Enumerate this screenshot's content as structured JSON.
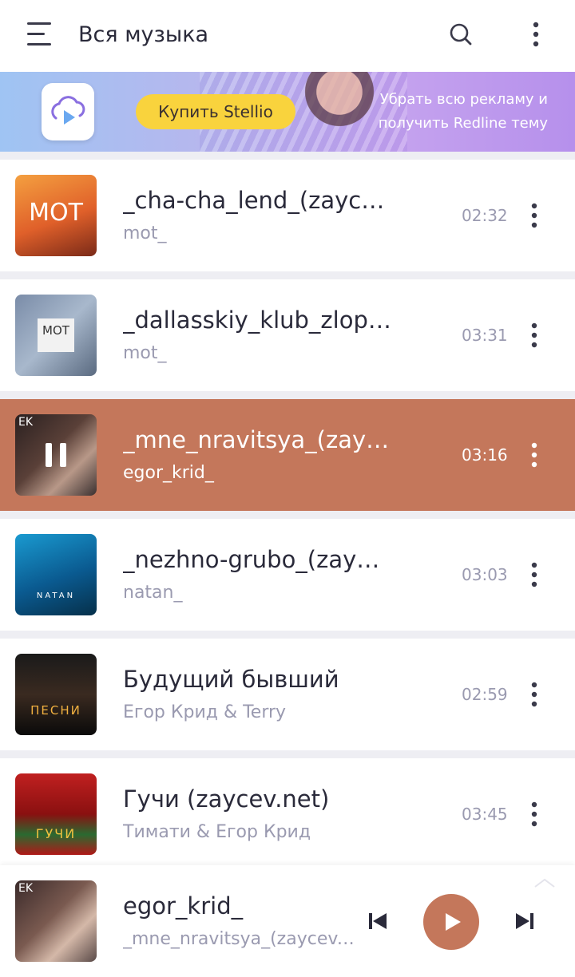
{
  "header": {
    "title": "Вся музыка",
    "menu_icon": "hamburger-menu-icon",
    "search_icon": "search-icon",
    "more_icon": "more-vertical-icon"
  },
  "banner": {
    "buy_label": "Купить Stellio",
    "promo_line1": "Убрать всю рекламу и",
    "promo_line2": "получить Redline тему",
    "colors": {
      "button": "#f9d33d",
      "from": "#9fc4f3",
      "to": "#b690ec"
    }
  },
  "tracks": [
    {
      "title": "_cha-cha_lend_(zaycev.net)",
      "artist": "mot_",
      "duration": "02:32",
      "cover_text": "МОТ",
      "active": false
    },
    {
      "title": "_dallasskiy_klub_zlopoluchnyh_(zaycev.net)",
      "artist": "mot_",
      "duration": "03:31",
      "cover_text": "МОТ",
      "active": false
    },
    {
      "title": "_mne_nravitsya_(zaycev.net)",
      "artist": "egor_krid_",
      "duration": "03:16",
      "cover_text": "EK",
      "active": true
    },
    {
      "title": "_nezhno-grubo_(zaycev.net)",
      "artist": "natan_",
      "duration": "03:03",
      "cover_text": "NATAN",
      "active": false
    },
    {
      "title": "Будущий бывший",
      "artist": "Егор Крид & Terry",
      "duration": "02:59",
      "cover_text": "ПЕСНИ",
      "active": false
    },
    {
      "title": "Гучи (zaycev.net)",
      "artist": "Тимати & Егор Крид",
      "duration": "03:45",
      "cover_text": "ГУЧИ",
      "active": false
    }
  ],
  "player": {
    "artist": "egor_krid_",
    "title": "_mne_nravitsya_(zaycev.net)",
    "cover_text": "EK",
    "accent": "#c4775b"
  }
}
